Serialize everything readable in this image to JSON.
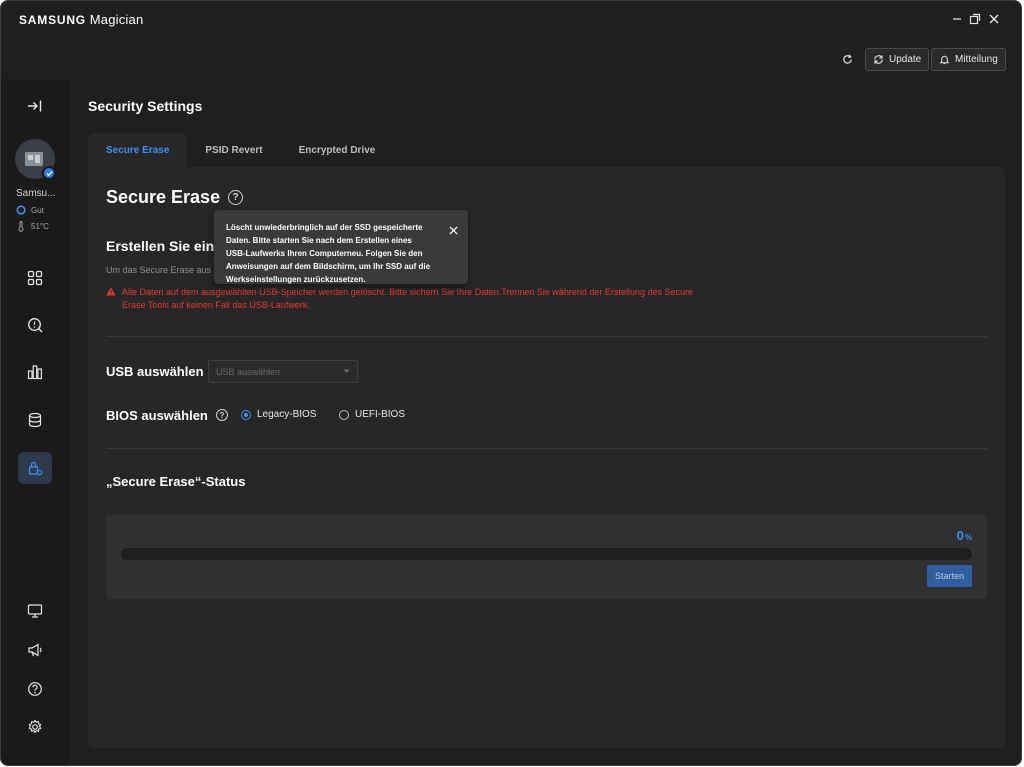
{
  "window": {
    "brand": "SAMSUNG",
    "app": "Magician"
  },
  "toolbar": {
    "update_label": "Update",
    "notice_label": "Mitteilung"
  },
  "device": {
    "name": "Samsu...",
    "health": "Gut",
    "temperature": "51°C"
  },
  "page": {
    "title": "Security Settings",
    "tabs": [
      {
        "label": "Secure Erase",
        "active": true
      },
      {
        "label": "PSID Revert",
        "active": false
      },
      {
        "label": "Encrypted Drive",
        "active": false
      }
    ]
  },
  "secure_erase": {
    "heading": "Secure Erase",
    "create_heading": "Erstellen Sie ein b",
    "description": "Um das Secure Erase aus",
    "warning": "Alle Daten auf dem ausgewählten USB-Speicher werden gelöscht. Bitte sichern Sie Ihre Daten.Trennen Sie während der Erstellung des Secure Erase Tools auf keinen Fall das USB-Laufwerk.",
    "usb_label": "USB auswählen",
    "usb_placeholder": "USB auswählen",
    "bios_label": "BIOS auswählen",
    "bios_options": [
      {
        "label": "Legacy-BIOS",
        "selected": true
      },
      {
        "label": "UEFI-BIOS",
        "selected": false
      }
    ],
    "status_heading": "„Secure Erase“-Status",
    "progress_value": "0",
    "progress_unit": "%",
    "progress_fraction": 0,
    "start_label": "Starten"
  },
  "tooltip": {
    "text": "Löscht unwiederbringlich auf der SSD gespeicherte Daten. Bitte starten Sie nach dem Erstellen eines USB-Laufwerks Ihren Computerneu. Folgen Sie den Anweisungen auf dem Bildschirm, um Ihr SSD auf die Werkseinstellungen zurückzusetzen."
  },
  "colors": {
    "accent": "#3d8ef0",
    "warning": "#e33a35",
    "background": "#1f1f1f",
    "panel": "#272727"
  },
  "icons": {
    "sidebar": [
      "collapse-icon",
      "dashboard-icon",
      "diagnostic-icon",
      "benchmark-icon",
      "drive-management-icon",
      "security-icon",
      "display-icon",
      "announcement-icon",
      "help-icon",
      "settings-icon"
    ]
  }
}
